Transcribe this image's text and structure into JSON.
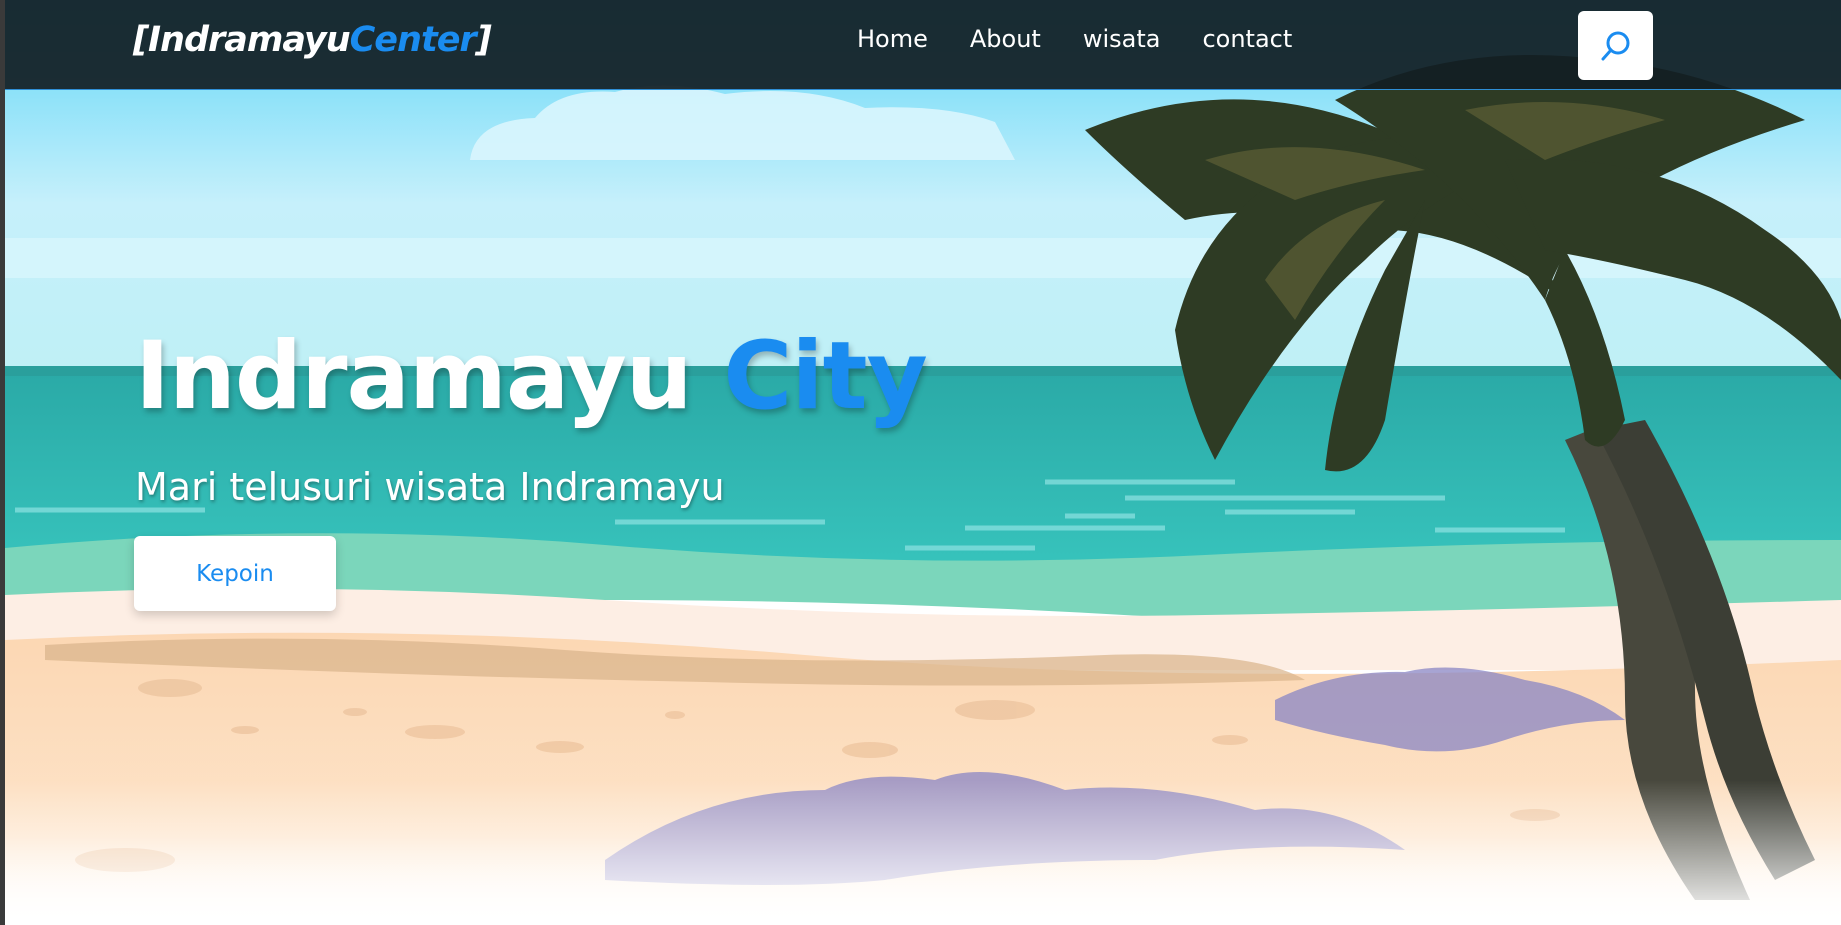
{
  "navbar": {
    "brand": {
      "open_bracket": "[",
      "main": "Indramayu",
      "accent": "Center",
      "close_bracket": "]"
    },
    "links": [
      {
        "label": "Home"
      },
      {
        "label": "About"
      },
      {
        "label": "wisata"
      },
      {
        "label": "contact"
      }
    ],
    "search_icon": "search-icon"
  },
  "hero": {
    "title_main": "Indramayu",
    "title_accent": "City",
    "subtitle": "Mari telusuri wisata Indramayu",
    "cta_label": "Kepoin"
  },
  "colors": {
    "accent": "#1a8cf0",
    "navbar_bg": "#121e24",
    "text_light": "#ffffff"
  }
}
